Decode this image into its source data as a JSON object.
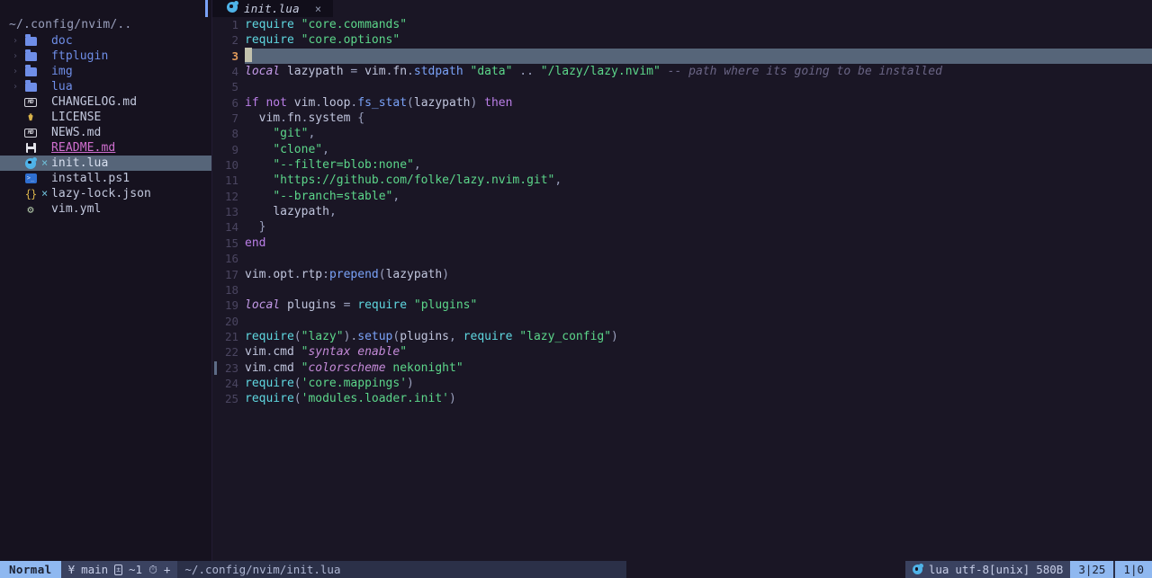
{
  "sidebar": {
    "root_label": "~/.config/nvim/..",
    "items": [
      {
        "label": "doc",
        "kind": "folder",
        "icon": "folder-icon",
        "chevron": "›",
        "modified": false,
        "selected": false
      },
      {
        "label": "ftplugin",
        "kind": "folder",
        "icon": "folder-icon",
        "chevron": "›",
        "modified": false,
        "selected": false
      },
      {
        "label": "img",
        "kind": "folder",
        "icon": "folder-icon",
        "chevron": "›",
        "modified": false,
        "selected": false
      },
      {
        "label": "lua",
        "kind": "folder",
        "icon": "folder-icon",
        "chevron": "›",
        "modified": false,
        "selected": false
      },
      {
        "label": "CHANGELOG.md",
        "kind": "file",
        "icon": "markdown-icon",
        "chevron": "",
        "modified": false,
        "selected": false
      },
      {
        "label": "LICENSE",
        "kind": "file",
        "icon": "license-icon",
        "chevron": "",
        "modified": false,
        "selected": false
      },
      {
        "label": "NEWS.md",
        "kind": "file",
        "icon": "markdown-icon",
        "chevron": "",
        "modified": false,
        "selected": false
      },
      {
        "label": "README.md",
        "kind": "readme",
        "icon": "floppy-icon",
        "chevron": "",
        "modified": false,
        "selected": false
      },
      {
        "label": "init.lua",
        "kind": "file",
        "icon": "lua-icon",
        "chevron": "",
        "modified": true,
        "selected": true
      },
      {
        "label": "install.ps1",
        "kind": "file",
        "icon": "powershell-icon",
        "chevron": "",
        "modified": false,
        "selected": false
      },
      {
        "label": "lazy-lock.json",
        "kind": "file",
        "icon": "json-icon",
        "chevron": "",
        "modified": true,
        "selected": false
      },
      {
        "label": "vim.yml",
        "kind": "file",
        "icon": "gear-icon",
        "chevron": "",
        "modified": false,
        "selected": false
      }
    ],
    "modified_marker": "×"
  },
  "tabline": {
    "tabs": [
      {
        "label": "init.lua",
        "icon": "lua-icon",
        "close": "×",
        "active": true
      }
    ]
  },
  "editor": {
    "cursor_line": 3,
    "marker_line": 23,
    "lines": [
      {
        "n": 1,
        "tokens": [
          {
            "t": "call",
            "v": "require"
          },
          {
            "t": "sp",
            "v": " "
          },
          {
            "t": "str",
            "v": "\"core.commands\""
          }
        ]
      },
      {
        "n": 2,
        "tokens": [
          {
            "t": "call",
            "v": "require"
          },
          {
            "t": "sp",
            "v": " "
          },
          {
            "t": "str",
            "v": "\"core.options\""
          }
        ]
      },
      {
        "n": 3,
        "tokens": [
          {
            "t": "cursor",
            "v": " "
          }
        ]
      },
      {
        "n": 4,
        "tokens": [
          {
            "t": "kw2",
            "v": "local"
          },
          {
            "t": "sp",
            "v": " "
          },
          {
            "t": "var",
            "v": "lazypath"
          },
          {
            "t": "sp",
            "v": " "
          },
          {
            "t": "op",
            "v": "="
          },
          {
            "t": "sp",
            "v": " "
          },
          {
            "t": "var",
            "v": "vim"
          },
          {
            "t": "punc",
            "v": "."
          },
          {
            "t": "var",
            "v": "fn"
          },
          {
            "t": "punc",
            "v": "."
          },
          {
            "t": "fn",
            "v": "stdpath"
          },
          {
            "t": "sp",
            "v": " "
          },
          {
            "t": "str",
            "v": "\"data\""
          },
          {
            "t": "sp",
            "v": " "
          },
          {
            "t": "op",
            "v": ".."
          },
          {
            "t": "sp",
            "v": " "
          },
          {
            "t": "str",
            "v": "\"/lazy/lazy.nvim\""
          },
          {
            "t": "sp",
            "v": " "
          },
          {
            "t": "cmt",
            "v": "-- path where its going to be installed"
          }
        ]
      },
      {
        "n": 5,
        "tokens": []
      },
      {
        "n": 6,
        "tokens": [
          {
            "t": "kw",
            "v": "if"
          },
          {
            "t": "sp",
            "v": " "
          },
          {
            "t": "kw",
            "v": "not"
          },
          {
            "t": "sp",
            "v": " "
          },
          {
            "t": "var",
            "v": "vim"
          },
          {
            "t": "punc",
            "v": "."
          },
          {
            "t": "var",
            "v": "loop"
          },
          {
            "t": "punc",
            "v": "."
          },
          {
            "t": "fn",
            "v": "fs_stat"
          },
          {
            "t": "punc",
            "v": "("
          },
          {
            "t": "var",
            "v": "lazypath"
          },
          {
            "t": "punc",
            "v": ")"
          },
          {
            "t": "sp",
            "v": " "
          },
          {
            "t": "kw",
            "v": "then"
          }
        ]
      },
      {
        "n": 7,
        "tokens": [
          {
            "t": "sp",
            "v": "  "
          },
          {
            "t": "var",
            "v": "vim"
          },
          {
            "t": "punc",
            "v": "."
          },
          {
            "t": "var",
            "v": "fn"
          },
          {
            "t": "punc",
            "v": "."
          },
          {
            "t": "var",
            "v": "system"
          },
          {
            "t": "sp",
            "v": " "
          },
          {
            "t": "punc",
            "v": "{"
          }
        ]
      },
      {
        "n": 8,
        "tokens": [
          {
            "t": "sp",
            "v": "    "
          },
          {
            "t": "str",
            "v": "\"git\""
          },
          {
            "t": "punc",
            "v": ","
          }
        ]
      },
      {
        "n": 9,
        "tokens": [
          {
            "t": "sp",
            "v": "    "
          },
          {
            "t": "str",
            "v": "\"clone\""
          },
          {
            "t": "punc",
            "v": ","
          }
        ]
      },
      {
        "n": 10,
        "tokens": [
          {
            "t": "sp",
            "v": "    "
          },
          {
            "t": "str",
            "v": "\"--filter=blob:none\""
          },
          {
            "t": "punc",
            "v": ","
          }
        ]
      },
      {
        "n": 11,
        "tokens": [
          {
            "t": "sp",
            "v": "    "
          },
          {
            "t": "str",
            "v": "\"https://github.com/folke/lazy.nvim.git\""
          },
          {
            "t": "punc",
            "v": ","
          }
        ]
      },
      {
        "n": 12,
        "tokens": [
          {
            "t": "sp",
            "v": "    "
          },
          {
            "t": "str",
            "v": "\"--branch=stable\""
          },
          {
            "t": "punc",
            "v": ","
          }
        ]
      },
      {
        "n": 13,
        "tokens": [
          {
            "t": "sp",
            "v": "    "
          },
          {
            "t": "var",
            "v": "lazypath"
          },
          {
            "t": "punc",
            "v": ","
          }
        ]
      },
      {
        "n": 14,
        "tokens": [
          {
            "t": "sp",
            "v": "  "
          },
          {
            "t": "punc",
            "v": "}"
          }
        ]
      },
      {
        "n": 15,
        "tokens": [
          {
            "t": "kw",
            "v": "end"
          }
        ]
      },
      {
        "n": 16,
        "tokens": []
      },
      {
        "n": 17,
        "tokens": [
          {
            "t": "var",
            "v": "vim"
          },
          {
            "t": "punc",
            "v": "."
          },
          {
            "t": "var",
            "v": "opt"
          },
          {
            "t": "punc",
            "v": "."
          },
          {
            "t": "var",
            "v": "rtp"
          },
          {
            "t": "punc",
            "v": ":"
          },
          {
            "t": "fn",
            "v": "prepend"
          },
          {
            "t": "punc",
            "v": "("
          },
          {
            "t": "var",
            "v": "lazypath"
          },
          {
            "t": "punc",
            "v": ")"
          }
        ]
      },
      {
        "n": 18,
        "tokens": []
      },
      {
        "n": 19,
        "tokens": [
          {
            "t": "kw2",
            "v": "local"
          },
          {
            "t": "sp",
            "v": " "
          },
          {
            "t": "var",
            "v": "plugins"
          },
          {
            "t": "sp",
            "v": " "
          },
          {
            "t": "op",
            "v": "="
          },
          {
            "t": "sp",
            "v": " "
          },
          {
            "t": "call",
            "v": "require"
          },
          {
            "t": "sp",
            "v": " "
          },
          {
            "t": "str",
            "v": "\"plugins\""
          }
        ]
      },
      {
        "n": 20,
        "tokens": []
      },
      {
        "n": 21,
        "tokens": [
          {
            "t": "call",
            "v": "require"
          },
          {
            "t": "punc",
            "v": "("
          },
          {
            "t": "str",
            "v": "\"lazy\""
          },
          {
            "t": "punc",
            "v": ")."
          },
          {
            "t": "fn",
            "v": "setup"
          },
          {
            "t": "punc",
            "v": "("
          },
          {
            "t": "var",
            "v": "plugins"
          },
          {
            "t": "punc",
            "v": ","
          },
          {
            "t": "sp",
            "v": " "
          },
          {
            "t": "call",
            "v": "require"
          },
          {
            "t": "sp",
            "v": " "
          },
          {
            "t": "str",
            "v": "\"lazy_config\""
          },
          {
            "t": "punc",
            "v": ")"
          }
        ]
      },
      {
        "n": 22,
        "tokens": [
          {
            "t": "var",
            "v": "vim"
          },
          {
            "t": "punc",
            "v": "."
          },
          {
            "t": "var",
            "v": "cmd"
          },
          {
            "t": "sp",
            "v": " "
          },
          {
            "t": "str",
            "v": "\""
          },
          {
            "t": "strit",
            "v": "syntax enable"
          },
          {
            "t": "str",
            "v": "\""
          }
        ]
      },
      {
        "n": 23,
        "tokens": [
          {
            "t": "var",
            "v": "vim"
          },
          {
            "t": "punc",
            "v": "."
          },
          {
            "t": "var",
            "v": "cmd"
          },
          {
            "t": "sp",
            "v": " "
          },
          {
            "t": "str",
            "v": "\""
          },
          {
            "t": "strit",
            "v": "colorscheme"
          },
          {
            "t": "str",
            "v": " nekonight\""
          }
        ]
      },
      {
        "n": 24,
        "tokens": [
          {
            "t": "call",
            "v": "require"
          },
          {
            "t": "punc",
            "v": "("
          },
          {
            "t": "str",
            "v": "'core.mappings'"
          },
          {
            "t": "punc",
            "v": ")"
          }
        ]
      },
      {
        "n": 25,
        "tokens": [
          {
            "t": "call",
            "v": "require"
          },
          {
            "t": "punc",
            "v": "("
          },
          {
            "t": "str",
            "v": "'modules.loader.init'"
          },
          {
            "t": "punc",
            "v": ")"
          }
        ]
      }
    ]
  },
  "statusline": {
    "mode": "Normal",
    "git_branch_icon": "git-branch-icon",
    "git_branch": "main",
    "diff_icon": "diff-modified-icon",
    "diff_count": "~1",
    "diag_icon": "diagnostic-icon",
    "diag_count": "+",
    "file_path": "~/.config/nvim/init.lua",
    "filetype_icon": "lua-icon",
    "filetype": "lua",
    "encoding": "utf-8[unix]",
    "filesize": "580B",
    "position": "3|25",
    "progress": "1|0"
  },
  "colors": {
    "editor_bg": "#1a1625",
    "sidebar_bg": "#16121f",
    "accent": "#7aa2f7",
    "mode_bg": "#8fb8f0",
    "cursorline": "#566579",
    "string": "#5cd68a",
    "keyword": "#bb7fe8",
    "function": "#7aa2f7",
    "call": "#5fd7e0",
    "comment": "#6a6585",
    "folder": "#6f8ee8",
    "readme": "#d06fd0",
    "linenr_cursor": "#e09a5a"
  }
}
